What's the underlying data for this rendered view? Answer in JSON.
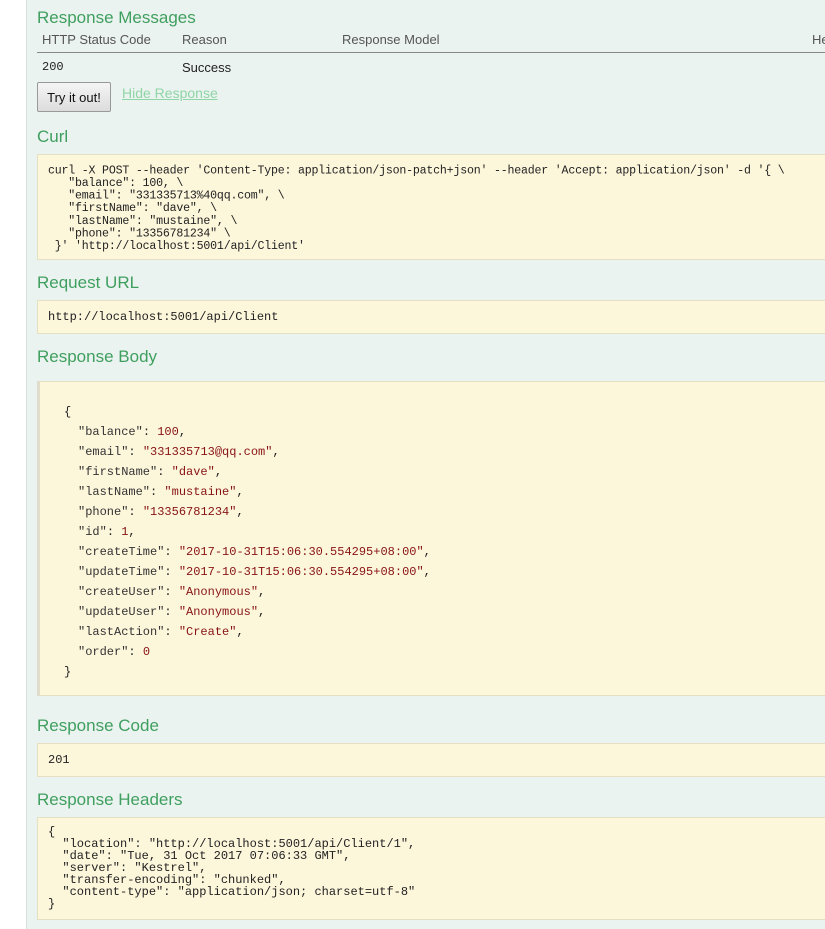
{
  "response_messages": {
    "title": "Response Messages",
    "columns": [
      "HTTP Status Code",
      "Reason",
      "Response Model",
      "He"
    ],
    "rows": [
      {
        "code": "200",
        "reason": "Success"
      }
    ]
  },
  "actions": {
    "try_label": "Try it out!",
    "hide_label": "Hide Response"
  },
  "curl": {
    "title": "Curl",
    "text": "curl -X POST --header 'Content-Type: application/json-patch+json' --header 'Accept: application/json' -d '{ \\\n   \"balance\": 100, \\\n   \"email\": \"331335713%40qq.com\", \\\n   \"firstName\": \"dave\", \\\n   \"lastName\": \"mustaine\", \\\n   \"phone\": \"13356781234\" \\\n }' 'http://localhost:5001/api/Client'"
  },
  "request_url": {
    "title": "Request URL",
    "value": "http://localhost:5001/api/Client"
  },
  "response_body": {
    "title": "Response Body",
    "open": "{",
    "close": "}",
    "fields": [
      {
        "key": "\"balance\"",
        "value": "100",
        "sep": ","
      },
      {
        "key": "\"email\"",
        "value": "\"331335713@qq.com\"",
        "sep": ","
      },
      {
        "key": "\"firstName\"",
        "value": "\"dave\"",
        "sep": ","
      },
      {
        "key": "\"lastName\"",
        "value": "\"mustaine\"",
        "sep": ","
      },
      {
        "key": "\"phone\"",
        "value": "\"13356781234\"",
        "sep": ","
      },
      {
        "key": "\"id\"",
        "value": "1",
        "sep": ","
      },
      {
        "key": "\"createTime\"",
        "value": "\"2017-10-31T15:06:30.554295+08:00\"",
        "sep": ","
      },
      {
        "key": "\"updateTime\"",
        "value": "\"2017-10-31T15:06:30.554295+08:00\"",
        "sep": ","
      },
      {
        "key": "\"createUser\"",
        "value": "\"Anonymous\"",
        "sep": ","
      },
      {
        "key": "\"updateUser\"",
        "value": "\"Anonymous\"",
        "sep": ","
      },
      {
        "key": "\"lastAction\"",
        "value": "\"Create\"",
        "sep": ","
      },
      {
        "key": "\"order\"",
        "value": "0",
        "sep": ""
      }
    ]
  },
  "response_code": {
    "title": "Response Code",
    "value": "201"
  },
  "response_headers": {
    "title": "Response Headers",
    "text": "{\n  \"location\": \"http://localhost:5001/api/Client/1\",\n  \"date\": \"Tue, 31 Oct 2017 07:06:33 GMT\",\n  \"server\": \"Kestrel\",\n  \"transfer-encoding\": \"chunked\",\n  \"content-type\": \"application/json; charset=utf-8\"\n}"
  }
}
